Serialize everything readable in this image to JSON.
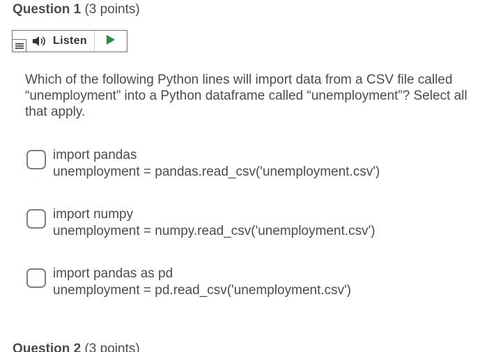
{
  "question": {
    "label": "Question 1",
    "points": "(3 points)"
  },
  "listen": {
    "label": "Listen"
  },
  "prompt": "Which of the following Python lines will import data from a CSV file called “unemployment” into a Python dataframe called “unemployment”? Select all that apply.",
  "options": [
    {
      "line1": "import pandas",
      "line2": "unemployment = pandas.read_csv('unemployment.csv')",
      "checked": false
    },
    {
      "line1": "import numpy",
      "line2": "unemployment = numpy.read_csv('unemployment.csv')",
      "checked": false
    },
    {
      "line1": "import pandas as pd",
      "line2": "unemployment = pd.read_csv('unemployment.csv')",
      "checked": false
    }
  ],
  "next_question": {
    "label": "Question 2",
    "points": "(3 points)"
  },
  "colors": {
    "text": "#494c4e",
    "play": "#2e8b3e",
    "border": "#6e7376"
  },
  "icons": [
    "menu-icon",
    "speaker-icon",
    "play-icon"
  ]
}
